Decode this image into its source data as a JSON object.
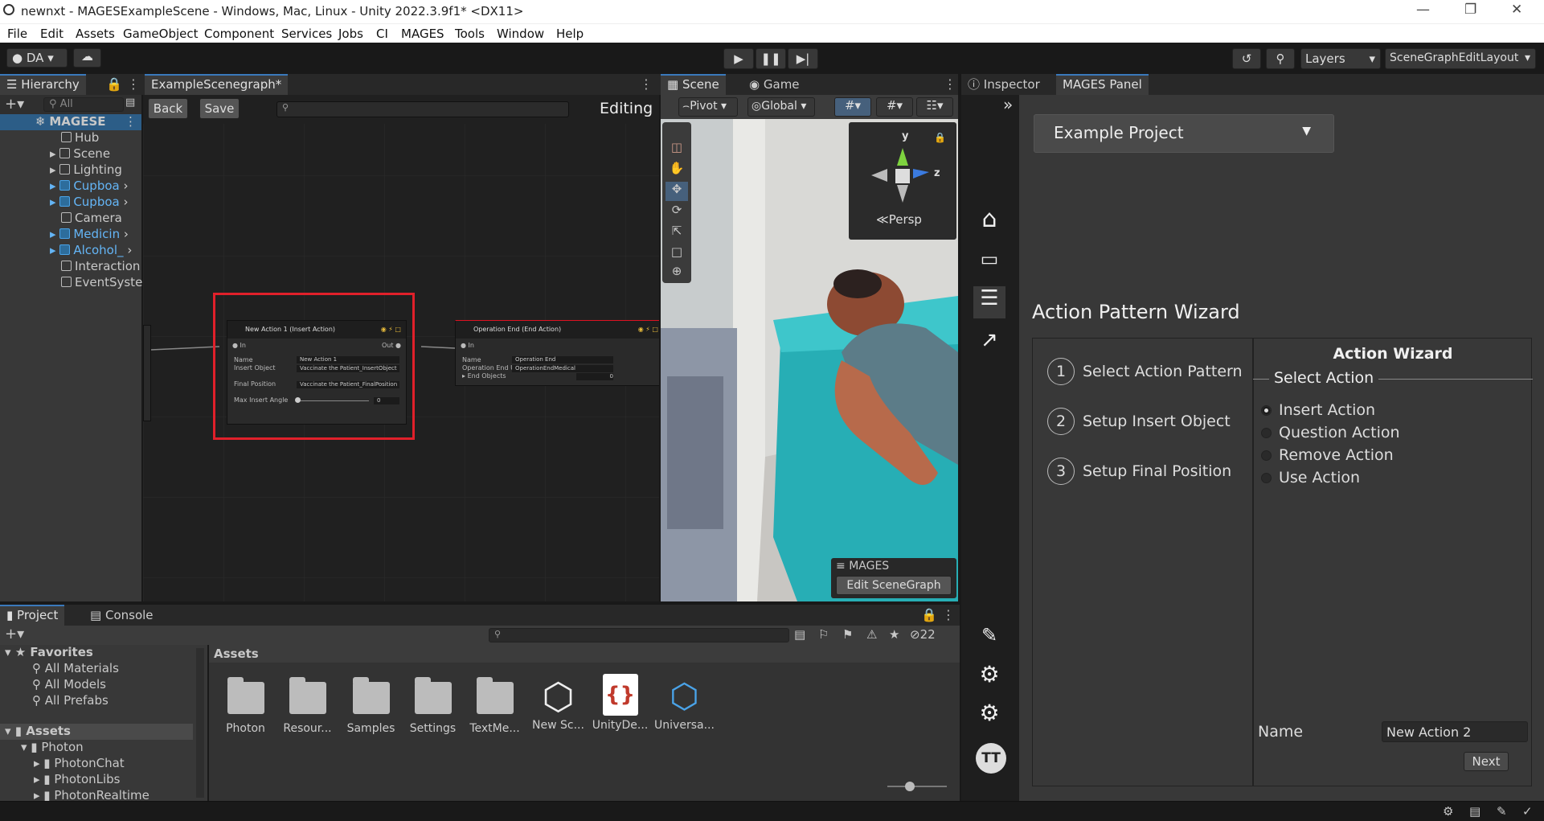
{
  "window": {
    "title": "newnxt - MAGESExampleScene - Windows, Mac, Linux - Unity 2022.3.9f1* <DX11>"
  },
  "menu": [
    "File",
    "Edit",
    "Assets",
    "GameObject",
    "Component",
    "Services",
    "Jobs",
    "CI",
    "MAGES",
    "Tools",
    "Window",
    "Help"
  ],
  "toolbar": {
    "account": "DA",
    "layers": "Layers",
    "layout": "SceneGraphEditLayout"
  },
  "hierarchy": {
    "tab": "Hierarchy",
    "search_placeholder": "All",
    "root": "MAGESE",
    "items": [
      "Hub",
      "Scene",
      "Lighting",
      "Cupboa",
      "Cupboa",
      "Camera",
      "Medicin",
      "Alcohol_",
      "Interaction",
      "EventSyste"
    ]
  },
  "scenegraph": {
    "tab": "ExampleScenegraph*",
    "back": "Back",
    "save": "Save",
    "mode": "Editing",
    "node1": {
      "title": "New Action 1 (Insert Action)",
      "in": "In",
      "out": "Out",
      "name_label": "Name",
      "name_value": "New Action 1",
      "insert_label": "Insert Object",
      "insert_value": "Vaccinate the Patient_InsertObject",
      "final_label": "Final Position",
      "final_value": "Vaccinate the Patient_FinalPosition",
      "angle_label": "Max Insert Angle",
      "angle_value": "0"
    },
    "node2": {
      "title": "Operation End (End Action)",
      "in": "In",
      "name_label": "Name",
      "name_value": "Operation End",
      "prefab_label": "Operation End UI Prefab",
      "prefab_value": "OperationEndMedical",
      "end_label": "End Objects",
      "end_value": "0"
    }
  },
  "scene": {
    "tab_scene": "Scene",
    "tab_game": "Game",
    "pivot": "Pivot",
    "global": "Global",
    "persp": "Persp",
    "gizmo_y": "y",
    "gizmo_z": "z",
    "mages_label": "MAGES",
    "edit_scenegraph": "Edit SceneGraph"
  },
  "inspector": {
    "tab_inspector": "Inspector",
    "tab_mages": "MAGES Panel",
    "project_select": "Example Project",
    "wizard_title": "Action Pattern Wizard",
    "steps": [
      {
        "num": "1",
        "label": "Select Action Pattern"
      },
      {
        "num": "2",
        "label": "Setup Insert Object"
      },
      {
        "num": "3",
        "label": "Setup Final Position"
      }
    ],
    "action_wizard": "Action Wizard",
    "select_action": "Select Action",
    "options": [
      "Insert Action",
      "Question Action",
      "Remove Action",
      "Use Action"
    ],
    "selected_option": "Insert Action",
    "name_label": "Name",
    "name_value": "New Action 2",
    "next": "Next",
    "avatar": "TT"
  },
  "project": {
    "tab_project": "Project",
    "tab_console": "Console",
    "hidden_count": "22",
    "favorites": "Favorites",
    "fav_items": [
      "All Materials",
      "All Models",
      "All Prefabs"
    ],
    "assets_root": "Assets",
    "tree": [
      "Photon",
      "PhotonChat",
      "PhotonLibs",
      "PhotonRealtime"
    ],
    "breadcrumb": "Assets",
    "assets": [
      "Photon",
      "Resour...",
      "Samples",
      "Settings",
      "TextMe...",
      "New Sc...",
      "UnityDe...",
      "Universa..."
    ]
  }
}
